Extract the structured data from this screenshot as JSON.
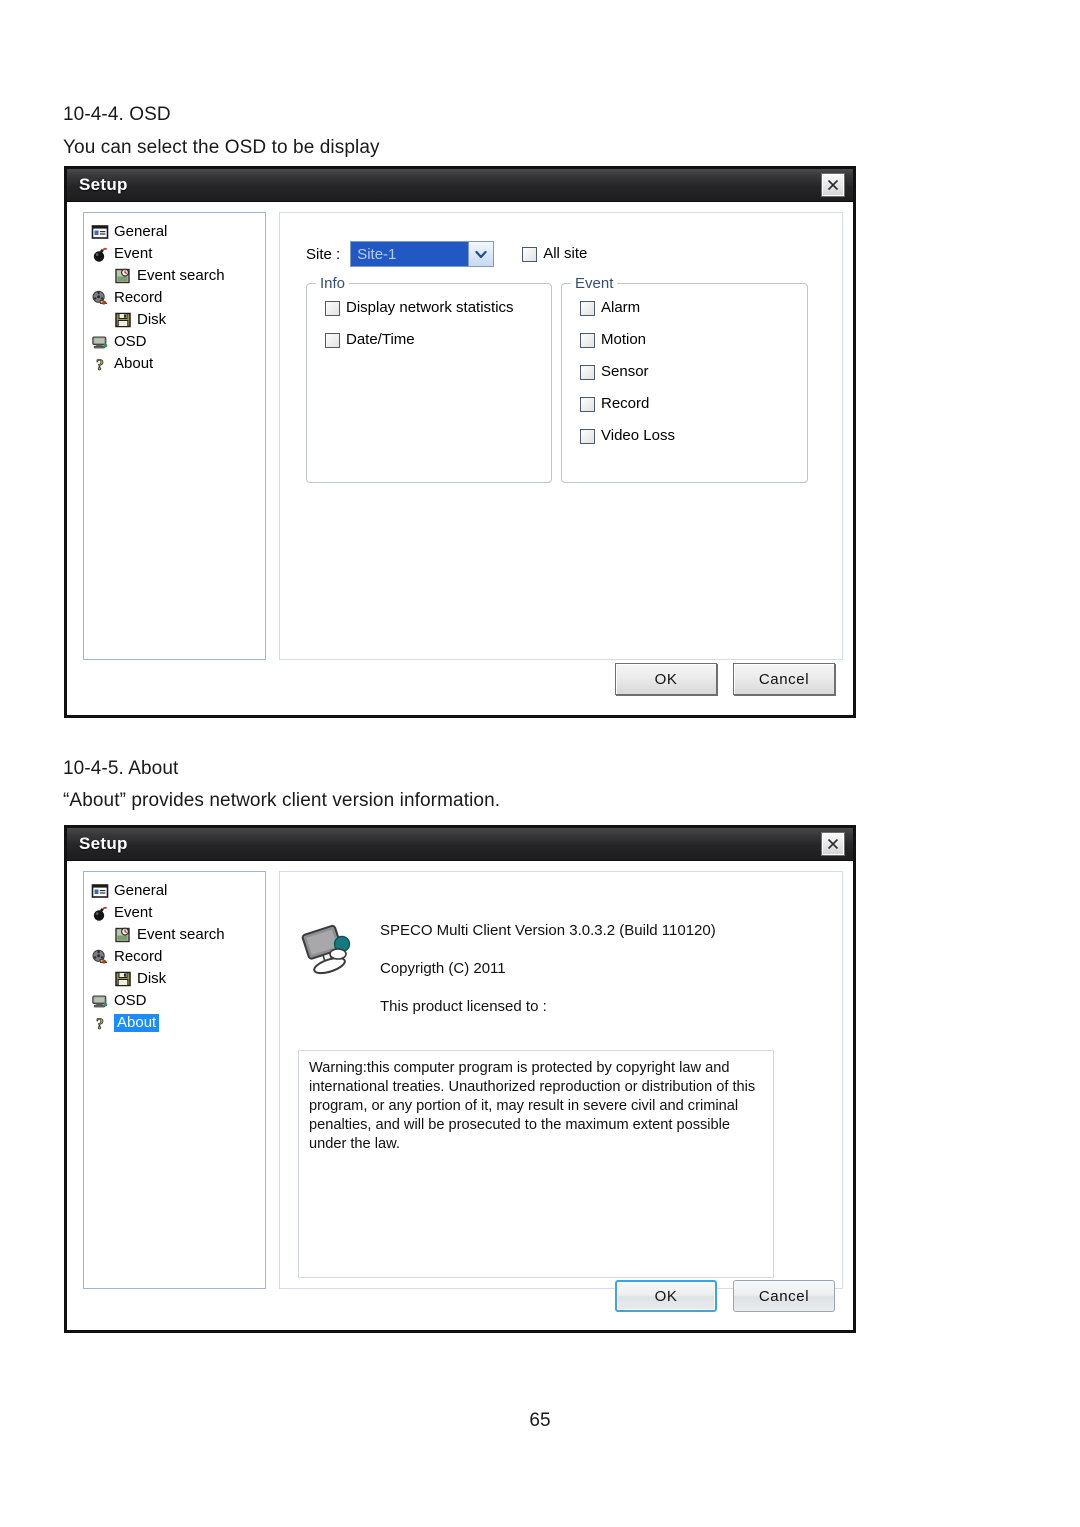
{
  "document": {
    "heading_osd": "10-4-4. OSD",
    "para_osd": "You can select the OSD to be display",
    "heading_about": "10-4-5. About",
    "para_about": "“About” provides network client version information.",
    "page_number": "65"
  },
  "colors": {
    "titlebar_dark": "#1d1d1f",
    "selection_blue": "#1a8cff",
    "combo_select_blue": "#2158c4",
    "legend_text": "#33506e",
    "focus_border": "#3ca5e0"
  },
  "dialog_osd": {
    "title": "Setup",
    "close_icon": "close-icon",
    "tree": [
      {
        "label": "General",
        "icon": "id-card-icon",
        "indent": false,
        "selected": false
      },
      {
        "label": "Event",
        "icon": "bomb-icon",
        "indent": false,
        "selected": false
      },
      {
        "label": "Event search",
        "icon": "search-clipboard-icon",
        "indent": true,
        "selected": false
      },
      {
        "label": "Record",
        "icon": "film-reel-icon",
        "indent": false,
        "selected": false
      },
      {
        "label": "Disk",
        "icon": "floppy-disk-icon",
        "indent": true,
        "selected": false
      },
      {
        "label": "OSD",
        "icon": "monitor-icon",
        "indent": false,
        "selected": false
      },
      {
        "label": "About",
        "icon": "question-mark-icon",
        "indent": false,
        "selected": false
      }
    ],
    "site": {
      "label": "Site :",
      "selected_value": "Site-1",
      "options": [
        "Site-1"
      ],
      "dropdown_icon": "chevron-down-icon",
      "all_site_label": "All site",
      "all_site_checked": false
    },
    "info_group": {
      "legend": "Info",
      "items": [
        {
          "label": "Display network statistics",
          "checked": false
        },
        {
          "label": "Date/Time",
          "checked": false
        }
      ]
    },
    "event_group": {
      "legend": "Event",
      "items": [
        {
          "label": "Alarm",
          "checked": false
        },
        {
          "label": "Motion",
          "checked": false
        },
        {
          "label": "Sensor",
          "checked": false
        },
        {
          "label": "Record",
          "checked": false
        },
        {
          "label": "Video Loss",
          "checked": false
        }
      ]
    },
    "buttons": {
      "ok": "OK",
      "cancel": "Cancel"
    }
  },
  "dialog_about": {
    "title": "Setup",
    "close_icon": "close-icon",
    "tree": [
      {
        "label": "General",
        "icon": "id-card-icon",
        "indent": false,
        "selected": false
      },
      {
        "label": "Event",
        "icon": "bomb-icon",
        "indent": false,
        "selected": false
      },
      {
        "label": "Event search",
        "icon": "search-clipboard-icon",
        "indent": true,
        "selected": false
      },
      {
        "label": "Record",
        "icon": "film-reel-icon",
        "indent": false,
        "selected": false
      },
      {
        "label": "Disk",
        "icon": "floppy-disk-icon",
        "indent": true,
        "selected": false
      },
      {
        "label": "OSD",
        "icon": "monitor-icon",
        "indent": false,
        "selected": false
      },
      {
        "label": "About",
        "icon": "question-mark-icon",
        "indent": false,
        "selected": true
      }
    ],
    "product_icon": "monitor-product-icon",
    "lines": [
      "SPECO Multi Client Version 3.0.3.2 (Build 110120)",
      "Copyrigth (C) 2011",
      "This product licensed to :"
    ],
    "warning": "Warning:this computer program is protected by copyright law and international treaties. Unauthorized reproduction or distribution of this program, or any portion of it, may result in severe civil and criminal penalties, and will be prosecuted to the maximum extent possible under the law.",
    "buttons": {
      "ok": "OK",
      "cancel": "Cancel"
    }
  }
}
